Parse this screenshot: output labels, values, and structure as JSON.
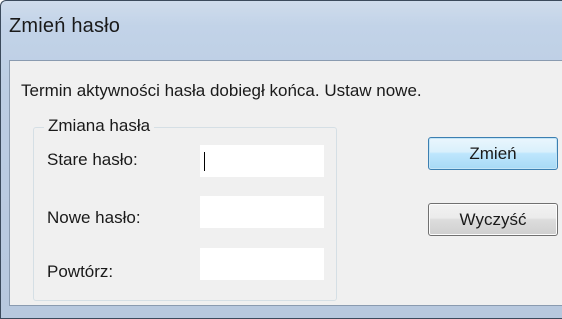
{
  "window": {
    "title": "Zmień hasło"
  },
  "dialog": {
    "message": "Termin aktywności hasła dobiegł końca. Ustaw nowe.",
    "group_title": "Zmiana hasła",
    "fields": [
      {
        "label": "Stare hasło:",
        "value": ""
      },
      {
        "label": "Nowe hasło:",
        "value": ""
      },
      {
        "label": "Powtórz:",
        "value": ""
      }
    ],
    "buttons": {
      "change": "Zmień",
      "clear": "Wyczyść"
    }
  },
  "colors": {
    "default_button_border": "#3c7fb1",
    "window_frame": "#bccde3",
    "client_background": "#f0f0f0"
  }
}
